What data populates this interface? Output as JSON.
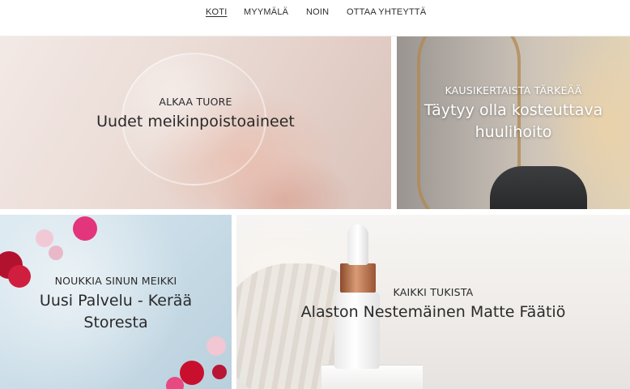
{
  "nav": {
    "items": [
      {
        "label": "KOTI",
        "active": true
      },
      {
        "label": "MYYMÄLÄ",
        "active": false
      },
      {
        "label": "NOIN",
        "active": false
      },
      {
        "label": "OTTAA YHTEYTTÄ",
        "active": false
      }
    ]
  },
  "tiles": [
    {
      "eyebrow": "ALKAA TUORE",
      "heading": "Uudet meikinpoistoaineet"
    },
    {
      "eyebrow": "KAUSIKERTAISTA TÄRKEÄÄ",
      "heading_line1": "Täytyy olla kosteuttava",
      "heading_line2": "huulihoito"
    },
    {
      "eyebrow": "NOUKKIA SINUN MEIKKI",
      "heading_line1": "Uusi Palvelu - Kerää",
      "heading_line2": "Storesta"
    },
    {
      "eyebrow": "KAIKKI TUKISTA",
      "heading": "Alaston Nestemäinen Matte Fäätiö"
    }
  ],
  "colors": {
    "text_dark": "#2a2a2a",
    "text_light": "#ffffff",
    "nav_text": "#2d2d2d"
  }
}
